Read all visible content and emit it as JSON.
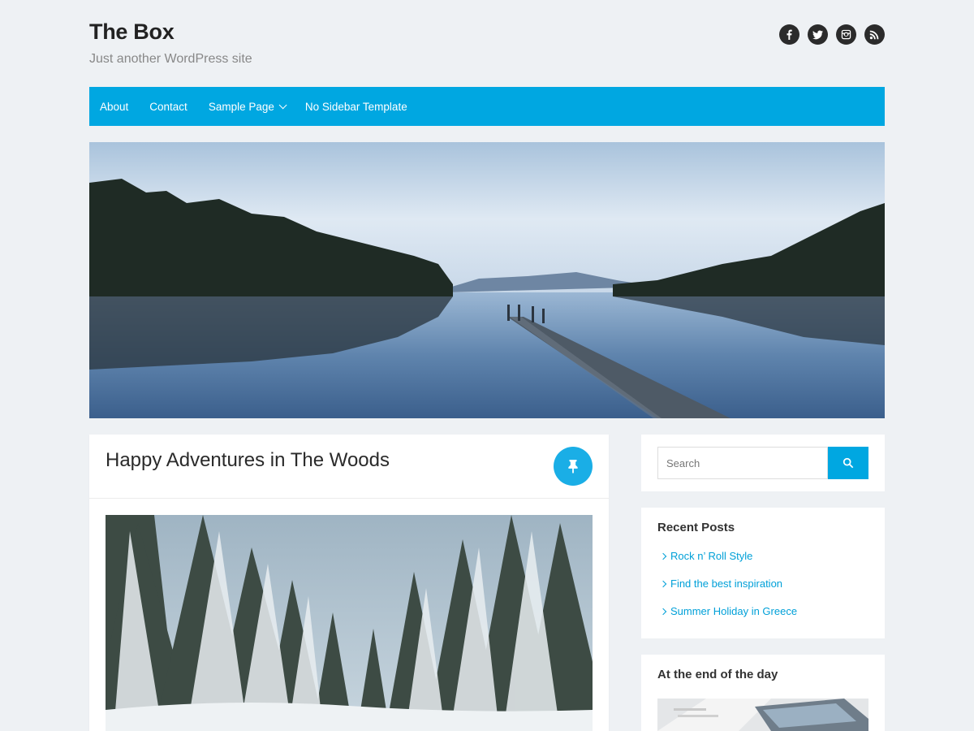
{
  "header": {
    "site_title": "The Box",
    "tagline": "Just another WordPress site",
    "social_icons": [
      "facebook-icon",
      "twitter-icon",
      "instagram-icon",
      "rss-icon"
    ]
  },
  "nav": {
    "items": [
      {
        "label": "About"
      },
      {
        "label": "Contact"
      },
      {
        "label": "Sample Page",
        "has_submenu": true
      },
      {
        "label": "No Sidebar Template"
      }
    ]
  },
  "hero": {
    "image": "lake-with-wooden-pier"
  },
  "post": {
    "title": "Happy Adventures in The Woods",
    "sticky_icon": "pin-icon",
    "image": "snowy-forest"
  },
  "sidebar": {
    "search": {
      "placeholder": "Search",
      "button_icon": "search-icon"
    },
    "recent_posts": {
      "title": "Recent Posts",
      "items": [
        "Rock n’ Roll Style",
        "Find the best inspiration",
        "Summer Holiday in Greece"
      ]
    },
    "end_of_day": {
      "title": "At the end of the day",
      "image": "laptop-desk"
    }
  },
  "colors": {
    "accent": "#00a7e1",
    "link": "#00a0d8",
    "background": "#eef1f4",
    "icon_dark": "#2b2b2b"
  }
}
